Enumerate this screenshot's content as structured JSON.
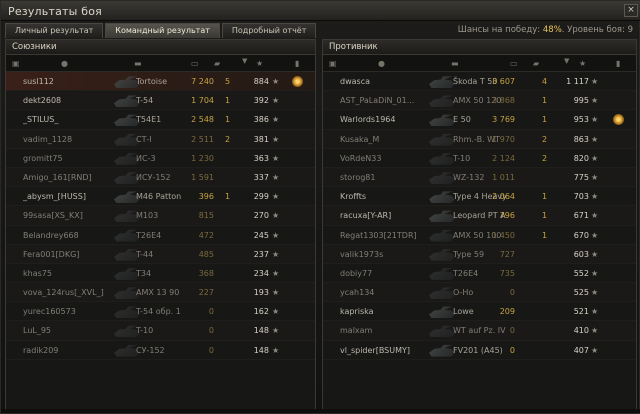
{
  "window": {
    "title": "Результаты боя",
    "close_label": "×"
  },
  "tabs": [
    {
      "label": "Личный результат"
    },
    {
      "label": "Командный результат",
      "active": true
    },
    {
      "label": "Подробный отчёт"
    }
  ],
  "chances": {
    "prefix": "Шансы на победу: ",
    "percent": "48%",
    "suffix": ". Уровень боя: 9"
  },
  "allies": {
    "title": "Союзники",
    "rows": [
      {
        "player": "susl112",
        "tank": "Tortoise",
        "damage": "7 240",
        "frags": "5",
        "xp": "884",
        "self": true,
        "medal": true
      },
      {
        "player": "dekt2608",
        "tank": "T-54",
        "damage": "1 704",
        "frags": "1",
        "xp": "392"
      },
      {
        "player": "_STILUS_",
        "tank": "T54E1",
        "damage": "2 548",
        "frags": "1",
        "xp": "386"
      },
      {
        "player": "vadim_1128",
        "tank": "СТ-I",
        "damage": "2 511",
        "frags": "2",
        "xp": "381",
        "dead": true
      },
      {
        "player": "gromitt75",
        "tank": "ИС-3",
        "damage": "1 230",
        "frags": "",
        "xp": "363",
        "dead": true
      },
      {
        "player": "Amigo_161[RND]",
        "tank": "ИСУ-152",
        "damage": "1 591",
        "frags": "",
        "xp": "337",
        "dead": true
      },
      {
        "player": "_abysm_[HUSS]",
        "tank": "M46 Patton",
        "damage": "396",
        "frags": "1",
        "xp": "299"
      },
      {
        "player": "99sasa[XS_KX]",
        "tank": "M103",
        "damage": "815",
        "frags": "",
        "xp": "270",
        "dead": true
      },
      {
        "player": "Belandrey668",
        "tank": "T26E4",
        "damage": "472",
        "frags": "",
        "xp": "245",
        "dead": true
      },
      {
        "player": "Fera001[DKG]",
        "tank": "T-44",
        "damage": "485",
        "frags": "",
        "xp": "237",
        "dead": true
      },
      {
        "player": "khas75",
        "tank": "T34",
        "damage": "368",
        "frags": "",
        "xp": "234",
        "dead": true
      },
      {
        "player": "vova_124rus[_XVL_]",
        "tank": "AMX 13 90",
        "damage": "227",
        "frags": "",
        "xp": "193",
        "dead": true
      },
      {
        "player": "yurec160573",
        "tank": "T-54 обр. 1",
        "damage": "0",
        "frags": "",
        "xp": "162",
        "dead": true
      },
      {
        "player": "LuL_95",
        "tank": "T-10",
        "damage": "0",
        "frags": "",
        "xp": "148",
        "dead": true
      },
      {
        "player": "radik209",
        "tank": "СУ-152",
        "damage": "0",
        "frags": "",
        "xp": "148",
        "dead": true
      }
    ]
  },
  "enemies": {
    "title": "Противник",
    "rows": [
      {
        "player": "dwasca",
        "tank": "Škoda T 50",
        "damage": "3 607",
        "frags": "4",
        "xp": "1 117"
      },
      {
        "player": "AST_PaLaDiN_01...",
        "tank": "AMX 50 120",
        "damage": "3 868",
        "frags": "1",
        "xp": "995",
        "dead": true
      },
      {
        "player": "Warlords1964",
        "tank": "E 50",
        "damage": "3 769",
        "frags": "1",
        "xp": "953",
        "medal": true
      },
      {
        "player": "Kusaka_M",
        "tank": "Rhm.-B. WT",
        "damage": "1 970",
        "frags": "2",
        "xp": "863",
        "dead": true
      },
      {
        "player": "VoRdeN33",
        "tank": "T-10",
        "damage": "2 124",
        "frags": "2",
        "xp": "820",
        "dead": true
      },
      {
        "player": "storog81",
        "tank": "WZ-132",
        "damage": "1 011",
        "frags": "",
        "xp": "775",
        "dead": true
      },
      {
        "player": "Kroffts",
        "tank": "Type 4 Heavy",
        "damage": "2 064",
        "frags": "1",
        "xp": "703"
      },
      {
        "player": "racuxa[Y-AR]",
        "tank": "Leopard PT A",
        "damage": "796",
        "frags": "1",
        "xp": "671"
      },
      {
        "player": "Regat1303[21TDR]",
        "tank": "AMX 50 100",
        "damage": "1 450",
        "frags": "1",
        "xp": "670",
        "dead": true
      },
      {
        "player": "valik1973s",
        "tank": "Type 59",
        "damage": "727",
        "frags": "",
        "xp": "603",
        "dead": true
      },
      {
        "player": "dobiy77",
        "tank": "T26E4",
        "damage": "735",
        "frags": "",
        "xp": "552",
        "dead": true
      },
      {
        "player": "ycah134",
        "tank": "O-Ho",
        "damage": "0",
        "frags": "",
        "xp": "525",
        "dead": true
      },
      {
        "player": "kapriska",
        "tank": "Lowe",
        "damage": "209",
        "frags": "",
        "xp": "521"
      },
      {
        "player": "malxam",
        "tank": "WT auf Pz. IV",
        "damage": "0",
        "frags": "",
        "xp": "410",
        "dead": true
      },
      {
        "player": "vl_spider[BSUMY]",
        "tank": "FV201 (A45)",
        "damage": "0",
        "frags": "",
        "xp": "407"
      }
    ]
  },
  "icons": {
    "squad": "squad-icon",
    "player": "player-icon",
    "tank": "tank-icon",
    "damage": "damage-icon",
    "frags": "frags-icon",
    "xp": "star-icon",
    "medal": "medal-icon"
  },
  "colors": {
    "accent": "#e8c35a",
    "self_row": "#3a2018",
    "damage": "#c6a33f"
  }
}
